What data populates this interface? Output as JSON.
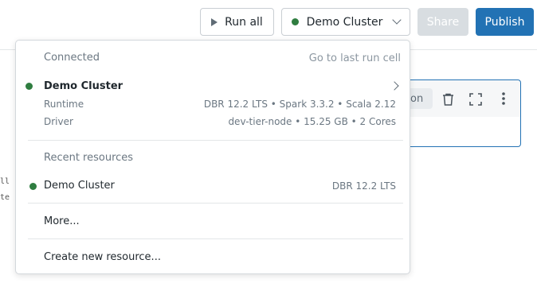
{
  "toolbar": {
    "run_all_label": "Run all",
    "cluster_label": "Demo Cluster",
    "share_label": "Share",
    "publish_label": "Publish"
  },
  "background_cell": {
    "chip_label": "on",
    "code_lines": [
      "ll",
      "te"
    ]
  },
  "dropdown": {
    "connected_heading": "Connected",
    "go_to_last_run_label": "Go to last run cell",
    "connected_cluster": {
      "name": "Demo Cluster",
      "runtime_label": "Runtime",
      "runtime_value": "DBR 12.2 LTS • Spark 3.3.2 • Scala 2.12",
      "driver_label": "Driver",
      "driver_value": "dev-tier-node • 15.25 GB • 2 Cores"
    },
    "recent_heading": "Recent resources",
    "recent_items": [
      {
        "name": "Demo Cluster",
        "runtime": "DBR 12.2 LTS"
      }
    ],
    "more_label": "More...",
    "create_label": "Create new resource..."
  },
  "colors": {
    "status_green": "#2f7d40",
    "primary_blue": "#2272b4",
    "disabled_gray": "#d8dde1"
  }
}
